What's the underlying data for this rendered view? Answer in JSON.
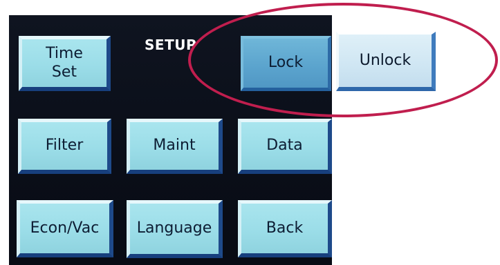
{
  "screen": {
    "header": "SETUP"
  },
  "buttons": {
    "time_set": "Time\nSet",
    "filter": "Filter",
    "maint": "Maint",
    "data": "Data",
    "econ_vac": "Econ/Vac",
    "language": "Language",
    "back": "Back",
    "lock": "Lock",
    "unlock": "Unlock"
  },
  "colors": {
    "button_face": "#9bdde8",
    "button_shadow": "#1e4a8a",
    "lock_selected": "#5aa3cd",
    "unlock_face": "#cfe6f3",
    "highlight_ring": "#c01e4e",
    "screen_background": "#0a0e18"
  }
}
